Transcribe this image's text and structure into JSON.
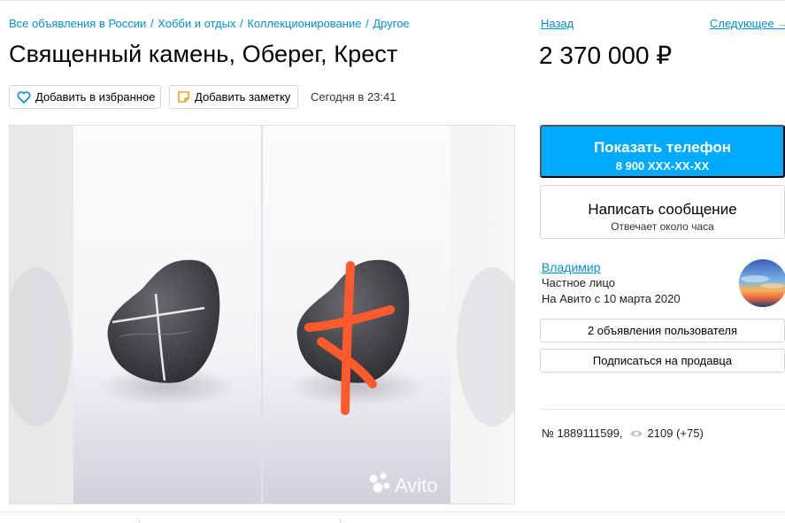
{
  "breadcrumb": [
    {
      "label": "Все объявления в России"
    },
    {
      "label": "Хобби и отдых"
    },
    {
      "label": "Коллекционирование"
    },
    {
      "label": "Другое"
    }
  ],
  "breadcrumb_separator": "/",
  "listing": {
    "title": "Священный камень, Оберег, Крест",
    "price": "2 370 000 ₽",
    "date": "Сегодня в 23:41",
    "number": "№ 1889111599,",
    "views": "2109 (+75)"
  },
  "actions": {
    "favorite_label": "Добавить в избранное",
    "note_label": "Добавить заметку"
  },
  "navigation": {
    "prev_label": "Назад",
    "next_label": "Следующее →"
  },
  "contact": {
    "phone_label": "Показать телефон",
    "phone_number": "8 900 XXX-XX-XX",
    "message_label": "Написать сообщение",
    "message_sub": "Отвечает около часа"
  },
  "seller": {
    "name": "Владимир",
    "type": "Частное лицо",
    "since": "На Авито с 10 марта 2020",
    "ads_label": "2 объявления пользователя",
    "subscribe_label": "Подписаться на продавца"
  },
  "gallery": {
    "watermark": "Avito"
  },
  "colors": {
    "link": "#0091d9",
    "accent": "#00aaff",
    "cross_marker": "#ff5a2b"
  }
}
